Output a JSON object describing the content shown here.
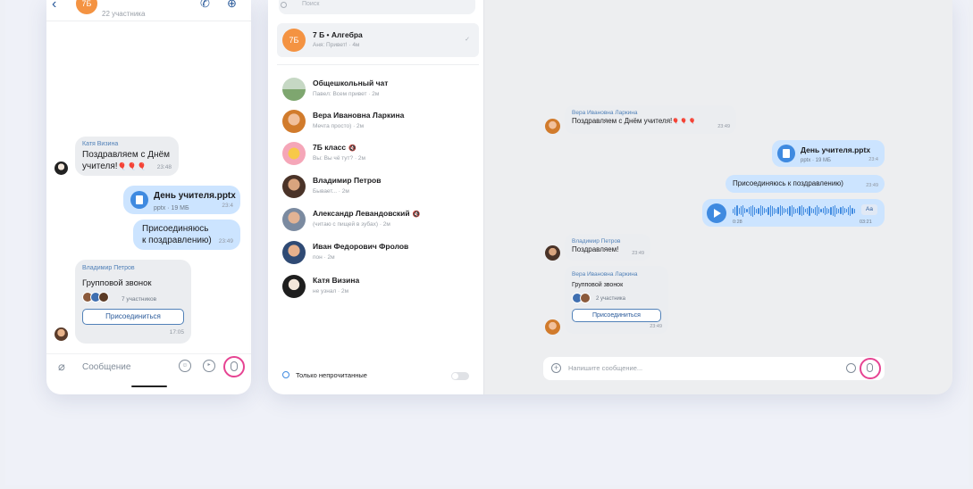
{
  "phone": {
    "header": {
      "avatar_text": "7Б",
      "subtitle": "22 участника"
    },
    "messages": [
      {
        "author": "Катя Визина",
        "text1": "Поздравляем с Днём",
        "text2": "учителя!",
        "emoji": "🎈🎈🎈",
        "time": "23:48"
      },
      {
        "file_name": "День учителя.pptx",
        "file_info": "pptx · 19 МБ",
        "time": "23:4"
      },
      {
        "text1": "Присоединяюсь",
        "text2": "к поздравлению)",
        "time": "23:49"
      }
    ],
    "call": {
      "author": "Владимир Петров",
      "title": "Групповой звонок",
      "participants": "7 участников",
      "join": "Присоединиться",
      "time": "17:05"
    },
    "input_placeholder": "Сообщение"
  },
  "tablet": {
    "search_placeholder": "Поиск",
    "selected_chat": {
      "avatar_text": "7Б",
      "name": "7 Б • Алгебра",
      "preview": "Аня: Привет! · 4м"
    },
    "chats": [
      {
        "name": "Общешкольный чат",
        "preview": "Павел: Всем привет · 2м",
        "muted": false
      },
      {
        "name": "Вера Ивановна Ларкина",
        "preview": "Мечта просто) · 2м",
        "muted": false
      },
      {
        "name": "7Б класс",
        "preview": "Вы: Вы чё тут? · 2м",
        "muted": true
      },
      {
        "name": "Владимир Петров",
        "preview": "Бывает... · 2м",
        "muted": false
      },
      {
        "name": "Александр Левандовский",
        "preview": "(читаю с пищей в зубах) · 2м",
        "muted": true
      },
      {
        "name": "Иван Федорович Фролов",
        "preview": "пон · 2м",
        "muted": false
      },
      {
        "name": "Катя Визина",
        "preview": "не узнал · 2м",
        "muted": false
      }
    ],
    "mute_glyph": "🔇",
    "unread_only": "Только непрочитанные",
    "conversation": {
      "m1": {
        "author": "Вера Ивановна Ларкина",
        "text": "Поздравляем с Днём учителя!",
        "emoji": "🎈🎈🎈",
        "time": "23:49"
      },
      "file": {
        "name": "День учителя.pptx",
        "info": "pptx · 19 МБ",
        "time": "23:4"
      },
      "m2": {
        "text": "Присоединяюсь к поздравлению)",
        "time": "23:49"
      },
      "voice": {
        "start": "0:28",
        "end": "03:21",
        "aa": "Aa"
      },
      "m3": {
        "author": "Владимир Петров",
        "text": "Поздравляем!",
        "time": "23:49"
      },
      "call": {
        "author": "Вера Ивановна Ларкина",
        "title": "Групповой звонок",
        "participants": "2 участника",
        "join": "Присоединиться",
        "time": "23:49"
      },
      "input_placeholder": "Напишите сообщение..."
    }
  },
  "colors": {
    "accent": "#3f8ae0",
    "highlight_ring": "#e64392",
    "out_bubble": "#cce4ff",
    "in_bubble": "#ebedf0"
  }
}
